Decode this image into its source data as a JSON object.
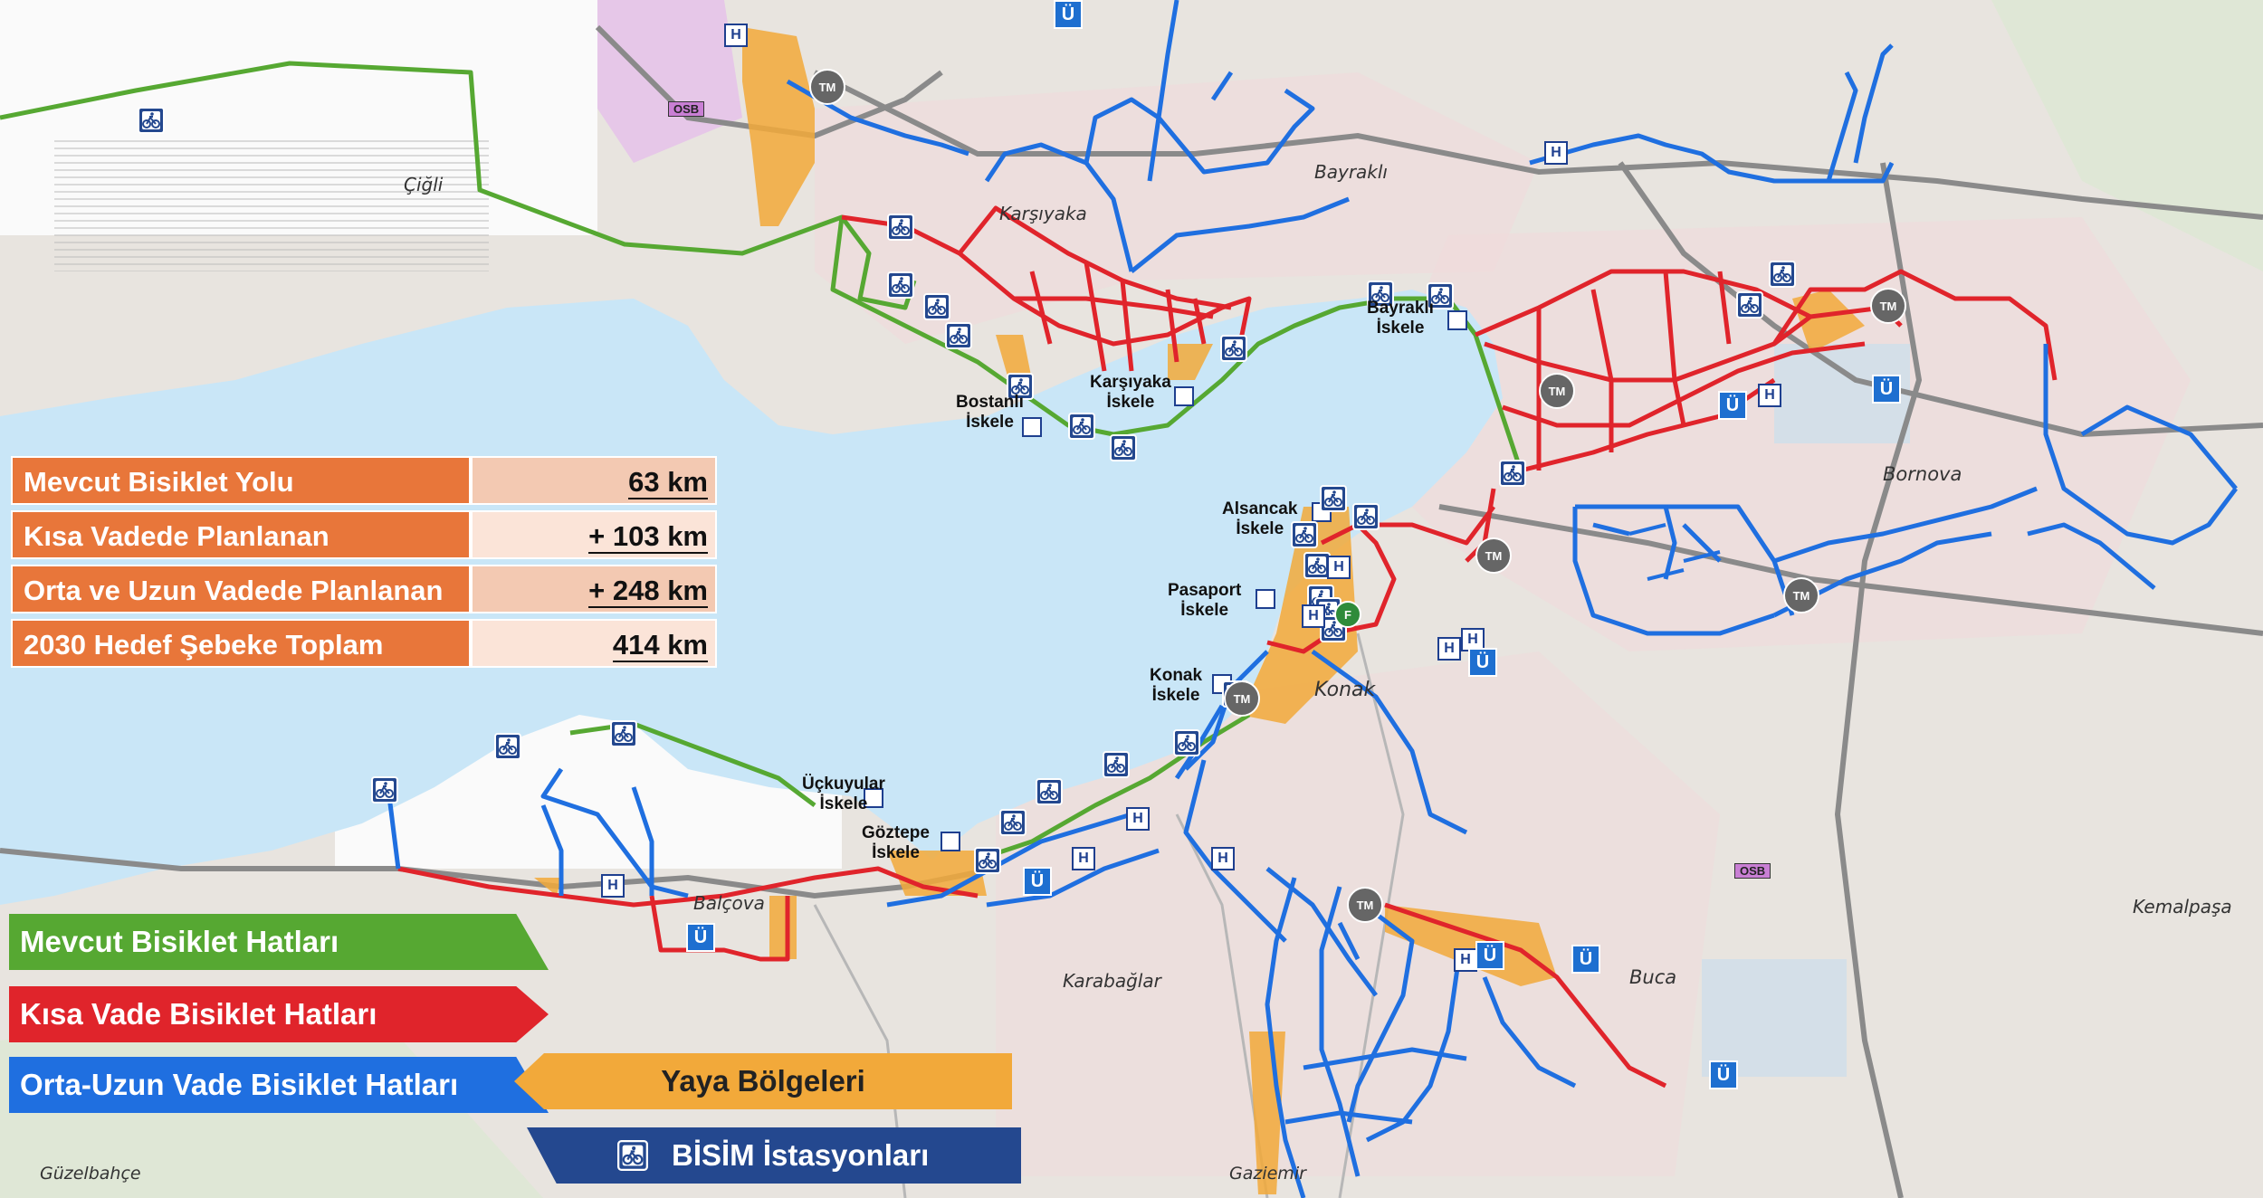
{
  "districts": {
    "cigli": "Çiğli",
    "karsiyaka": "Karşıyaka",
    "bayrakli": "Bayraklı",
    "bornova": "Bornova",
    "konak": "Konak",
    "balcova": "Balçova",
    "karabaglar": "Karabağlar",
    "buca": "Buca",
    "kemalpasa": "Kemalpaşa",
    "gaziemir": "Gaziemir",
    "guzelbahce": "Güzelbahçe"
  },
  "piers": {
    "bostanli": [
      "Bostanlı",
      "İskele"
    ],
    "karsiyaka": [
      "Karşıyaka",
      "İskele"
    ],
    "bayrakli": [
      "Bayraklı",
      "İskele"
    ],
    "alsancak": [
      "Alsancak",
      "İskele"
    ],
    "pasaport": [
      "Pasaport",
      "İskele"
    ],
    "konak": [
      "Konak",
      "İskele"
    ],
    "uckuyular": [
      "Üçkuyular",
      "İskele"
    ],
    "goztepe": [
      "Göztepe",
      "İskele"
    ]
  },
  "stats": [
    {
      "label": "Mevcut Bisiklet Yolu",
      "value": "63 km"
    },
    {
      "label": "Kısa Vadede Planlanan",
      "value": "+ 103 km"
    },
    {
      "label": "Orta ve Uzun Vadede Planlanan",
      "value": "+ 248 km"
    },
    {
      "label": "2030 Hedef Şebeke Toplam",
      "value": "414 km"
    }
  ],
  "legend": {
    "existing": {
      "label": "Mevcut Bisiklet Hatları",
      "color": "#56a832"
    },
    "short_term": {
      "label": "Kısa Vade Bisiklet Hatları",
      "color": "#e0242b"
    },
    "mid_long_term": {
      "label": "Orta-Uzun Vade Bisiklet Hatları",
      "color": "#1f6fe0"
    },
    "pedestrian": {
      "label": "Yaya Bölgeleri",
      "color": "#f2a93a"
    },
    "bisim": {
      "label": "BİSİM İstasyonları",
      "color": "#24488f"
    }
  },
  "poi_labels": {
    "hospital": "H",
    "terminal": "TM",
    "university": "Ü",
    "fair": "F",
    "industrial": "OSB"
  },
  "colors": {
    "sea": "#c9e6f7",
    "land": "#e8e4df",
    "urban": "#f1dede",
    "bisim_icon": "#24488f"
  }
}
